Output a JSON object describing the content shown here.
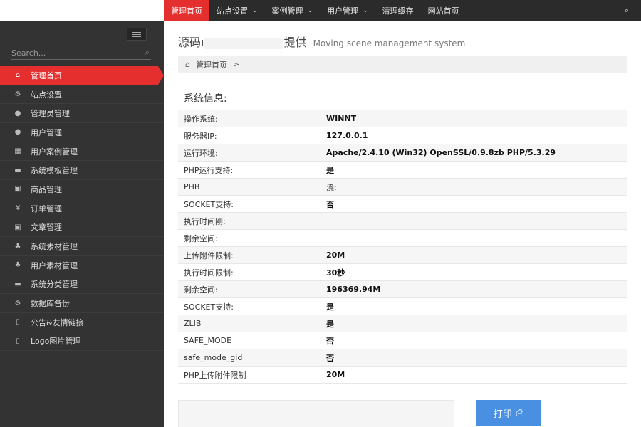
{
  "nav": {
    "items": [
      {
        "label": "管理首页",
        "caret": false
      },
      {
        "label": "站点设置",
        "caret": true
      },
      {
        "label": "案例管理",
        "caret": true
      },
      {
        "label": "用户管理",
        "caret": true
      },
      {
        "label": "清理缓存",
        "caret": false
      },
      {
        "label": "网站首页",
        "caret": false
      }
    ],
    "caret_glyph": "⌄",
    "search_glyph": "⌕"
  },
  "sidebar": {
    "search_placeholder": "Search...",
    "items": [
      {
        "icon": "home-icon",
        "glyph": "⌂",
        "label": "管理首页"
      },
      {
        "icon": "gears-icon",
        "glyph": "⚙",
        "label": "站点设置"
      },
      {
        "icon": "user-icon",
        "glyph": "●",
        "label": "管理员管理"
      },
      {
        "icon": "user-icon",
        "glyph": "●",
        "label": "用户管理"
      },
      {
        "icon": "table-icon",
        "glyph": "▦",
        "label": "用户案例管理"
      },
      {
        "icon": "briefcase-icon",
        "glyph": "▬",
        "label": "系统模板管理"
      },
      {
        "icon": "square-icon",
        "glyph": "▣",
        "label": "商品管理"
      },
      {
        "icon": "yen-icon",
        "glyph": "¥",
        "label": "订单管理"
      },
      {
        "icon": "square-icon",
        "glyph": "▣",
        "label": "文章管理"
      },
      {
        "icon": "tree-icon",
        "glyph": "♣",
        "label": "系统素材管理"
      },
      {
        "icon": "tree-icon",
        "glyph": "♣",
        "label": "用户素材管理"
      },
      {
        "icon": "briefcase-icon",
        "glyph": "▬",
        "label": "系统分类管理"
      },
      {
        "icon": "gears-icon",
        "glyph": "⚙",
        "label": "数据库备份"
      },
      {
        "icon": "bookmark-icon",
        "glyph": "▯",
        "label": "公告&友情链接"
      },
      {
        "icon": "bookmark-icon",
        "glyph": "▯",
        "label": "Logo图片管理"
      }
    ]
  },
  "main": {
    "title_left": "源码ı",
    "title_right": "提供",
    "title_sub": "Moving scene management system",
    "breadcrumb": {
      "home_glyph": "⌂",
      "label": "管理首页",
      "sep": ">"
    },
    "section_title": "系统信息:",
    "rows": [
      {
        "k": "操作系统:",
        "v": "WINNT"
      },
      {
        "k": "服务器IP:",
        "v": "127.0.0.1"
      },
      {
        "k": "运行环境:",
        "v": "Apache/2.4.10 (Win32) OpenSSL/0.9.8zb PHP/5.3.29"
      },
      {
        "k": "PHP运行支持:",
        "v": "是"
      },
      {
        "k": "PHB",
        "v": "浇:"
      },
      {
        "k": "SOCKET支持:",
        "v": "否"
      },
      {
        "k": "执行时间刚:",
        "v": ""
      },
      {
        "k": "剩余空间:",
        "v": ""
      },
      {
        "k": "上传附件限制:",
        "v": "20M"
      },
      {
        "k": "执行时间限制:",
        "v": "30秒"
      },
      {
        "k": "剩余空间:",
        "v": "196369.94M"
      },
      {
        "k": "SOCKET支持:",
        "v": "是"
      },
      {
        "k": "ZLIB",
        "v": "是"
      },
      {
        "k": "SAFE_MODE",
        "v": "否"
      },
      {
        "k": "safe_mode_gid",
        "v": "否"
      },
      {
        "k": "PHP上传附件限制",
        "v": "20M"
      }
    ],
    "print_label": "打印",
    "print_glyph": "⎙"
  }
}
